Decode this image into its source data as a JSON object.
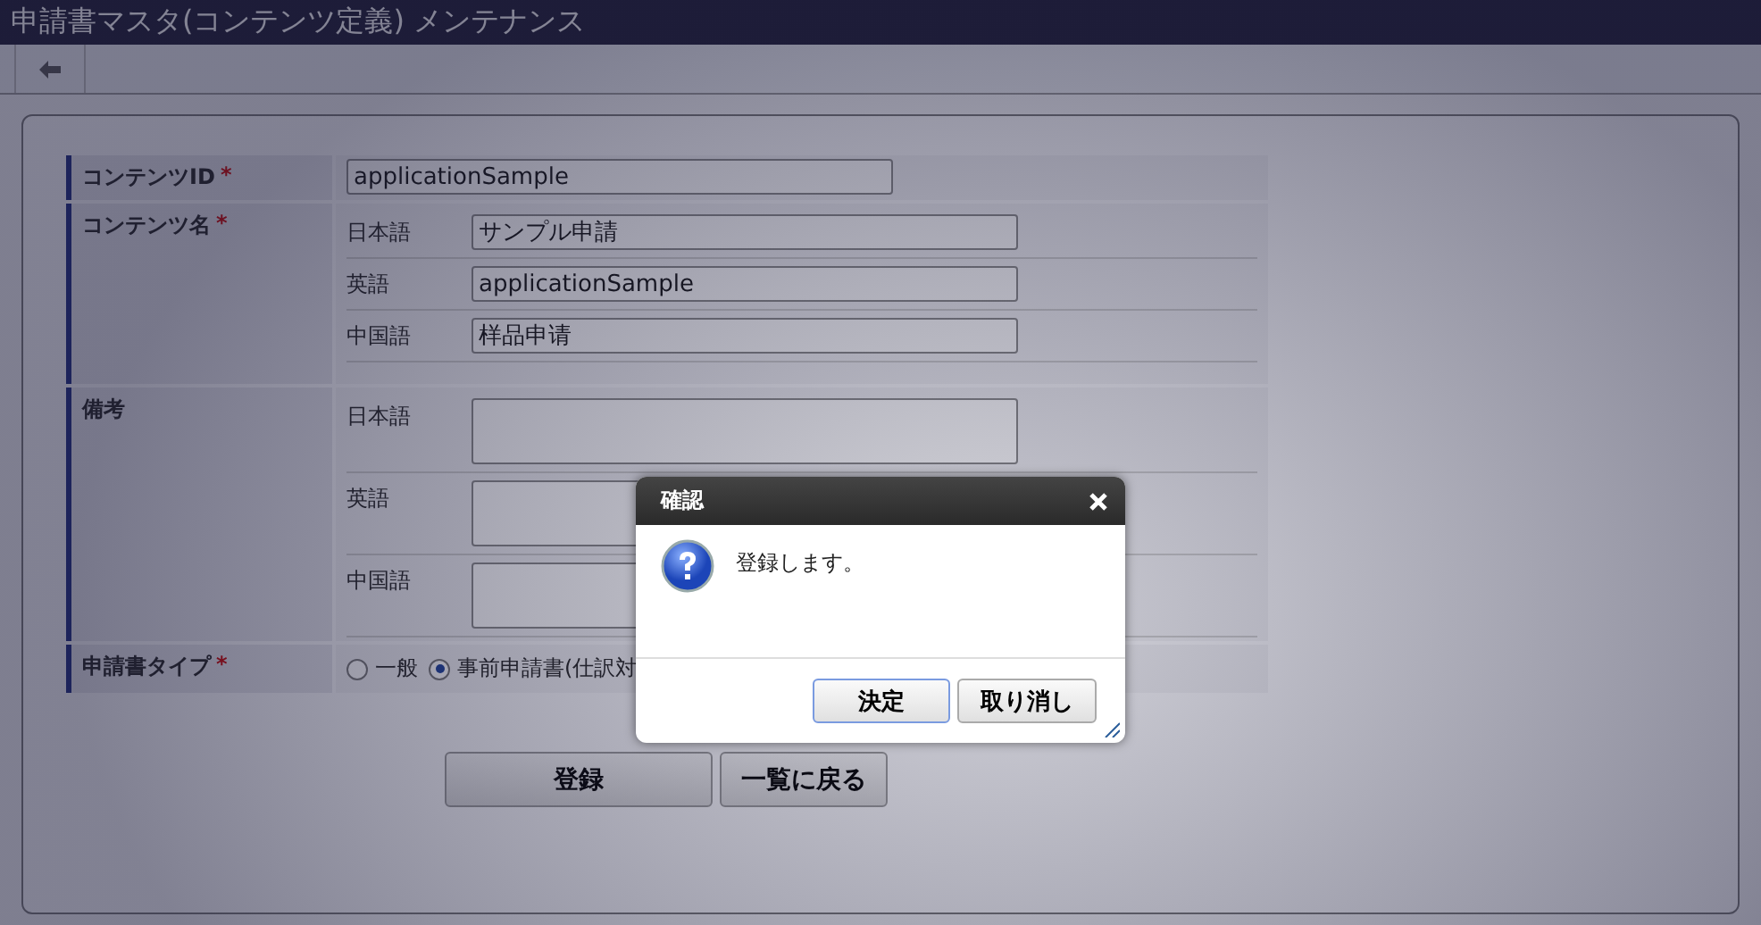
{
  "title": "申請書マスタ(コンテンツ定義) メンテナンス",
  "fields": [
    {
      "kind": "text",
      "label": "コンテンツID",
      "required_mark": "*",
      "value": "applicationSample"
    },
    {
      "kind": "localized",
      "label": "コンテンツ名",
      "required_mark": "*",
      "langs": [
        {
          "lang": "日本語",
          "value": "サンプル申請"
        },
        {
          "lang": "英語",
          "value": "applicationSample"
        },
        {
          "lang": "中国語",
          "value": "样品申请"
        }
      ]
    },
    {
      "kind": "notes",
      "label": "備考",
      "langs": [
        {
          "lang": "日本語"
        },
        {
          "lang": "英語"
        },
        {
          "lang": "中国語"
        }
      ]
    },
    {
      "kind": "radio",
      "label": "申請書タイプ",
      "required_mark": "*",
      "options": [
        {
          "label": "一般",
          "selected": false
        },
        {
          "label": "事前申請書(仕訳対",
          "selected": true
        }
      ]
    }
  ],
  "buttons": [
    "登録",
    "一覧に戻る"
  ],
  "dialog": {
    "title": "確認",
    "message": "登録します。",
    "buttons": [
      {
        "label": "決定",
        "focused": true
      },
      {
        "label": "取り消し",
        "focused": false
      }
    ]
  }
}
